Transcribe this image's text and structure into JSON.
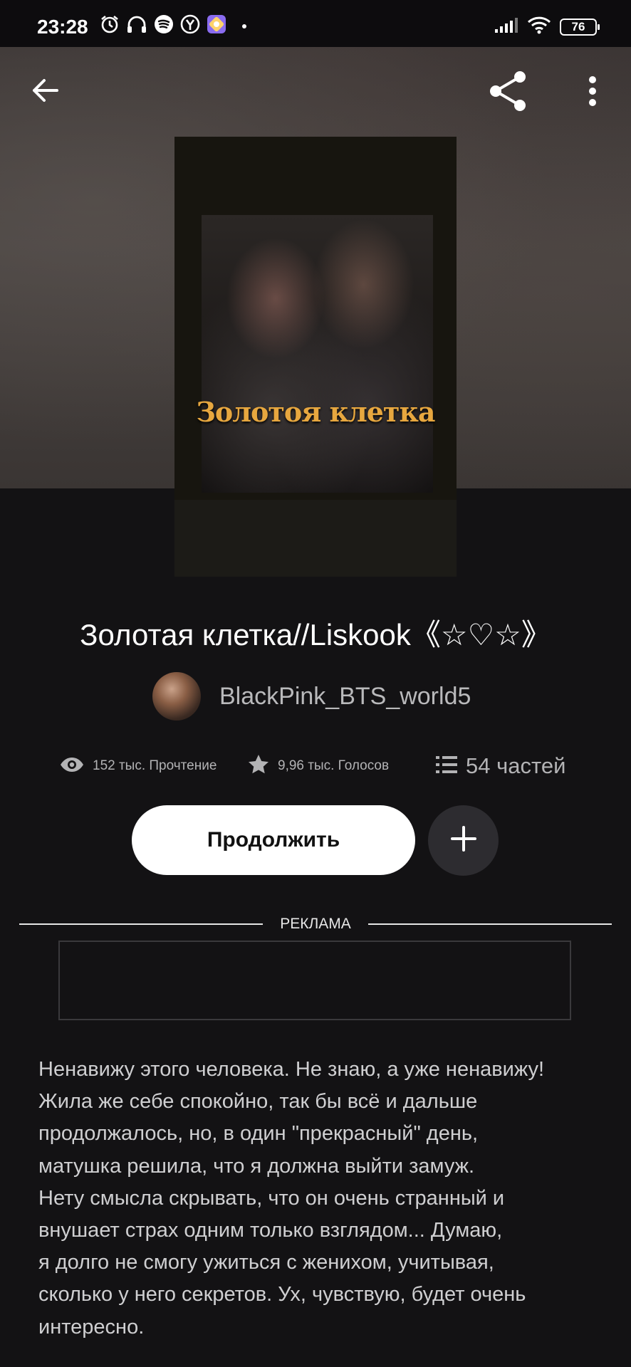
{
  "status_bar": {
    "time": "23:28",
    "battery": "76",
    "icons": [
      "alarm-icon",
      "headphones-icon",
      "spotify-icon",
      "yandex-icon",
      "app-icon",
      "dot-icon",
      "signal-icon",
      "wifi-icon",
      "battery-icon"
    ]
  },
  "toolbar": {
    "icons": [
      "back-arrow-icon",
      "share-icon",
      "more-vertical-icon"
    ]
  },
  "cover": {
    "title_text": "Золотоя клетка"
  },
  "story": {
    "title": "Золотая клетка//Liskook《☆♡☆》",
    "author": "BlackPink_BTS_world5",
    "reads": "152 тыс. Прочтение",
    "votes": "9,96 тыс. Голосов",
    "parts": "54 частей",
    "description": "Ненавижу этого человека. Не знаю, а уже ненавижу!\nЖила же себе спокойно, так бы всё и дальше\nпродолжалось, но, в один \"прекрасный\" день,\nматушка решила, что я должна выйти замуж.\nНету смысла скрывать, что он очень странный и\nвнушает страх одним только взглядом... Думаю,\nя долго не смогу ужиться с женихом, учитывая,\nсколько у него секретов. Ух, чувствую, будет очень\nинтересно."
  },
  "actions": {
    "continue_label": "Продолжить",
    "add_icon": "plus-icon"
  },
  "ad": {
    "label": "РЕКЛАМА"
  },
  "colors": {
    "background": "#131214",
    "cover_title": "#e7a73f",
    "button_bg": "#ffffff",
    "secondary_text": "#b3b3b5"
  }
}
